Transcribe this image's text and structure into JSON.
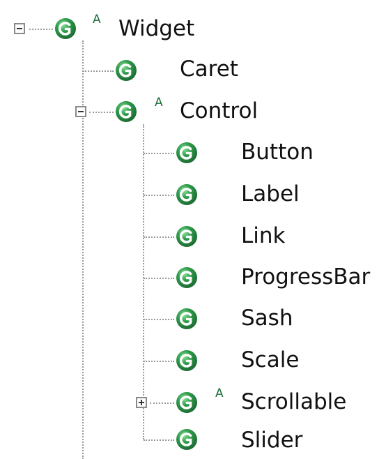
{
  "tree": {
    "root": {
      "label": "Widget",
      "icon": "class-icon",
      "abstract_badge": "A",
      "expanded": true
    },
    "level1": [
      {
        "label": "Caret",
        "icon": "class-icon"
      },
      {
        "label": "Control",
        "icon": "class-icon",
        "abstract_badge": "A",
        "expanded": true
      }
    ],
    "control_children": [
      {
        "label": "Button",
        "icon": "class-icon"
      },
      {
        "label": "Label",
        "icon": "class-icon"
      },
      {
        "label": "Link",
        "icon": "class-icon"
      },
      {
        "label": "ProgressBar",
        "icon": "class-icon"
      },
      {
        "label": "Sash",
        "icon": "class-icon"
      },
      {
        "label": "Scale",
        "icon": "class-icon"
      },
      {
        "label": "Scrollable",
        "icon": "class-icon",
        "abstract_badge": "A",
        "expanded": false
      },
      {
        "label": "Slider",
        "icon": "class-icon"
      }
    ]
  },
  "colors": {
    "icon_green": "#2e9a4a",
    "icon_dark": "#1c6b33",
    "badge": "#1f6d3b",
    "connector": "#9a9a9a"
  }
}
